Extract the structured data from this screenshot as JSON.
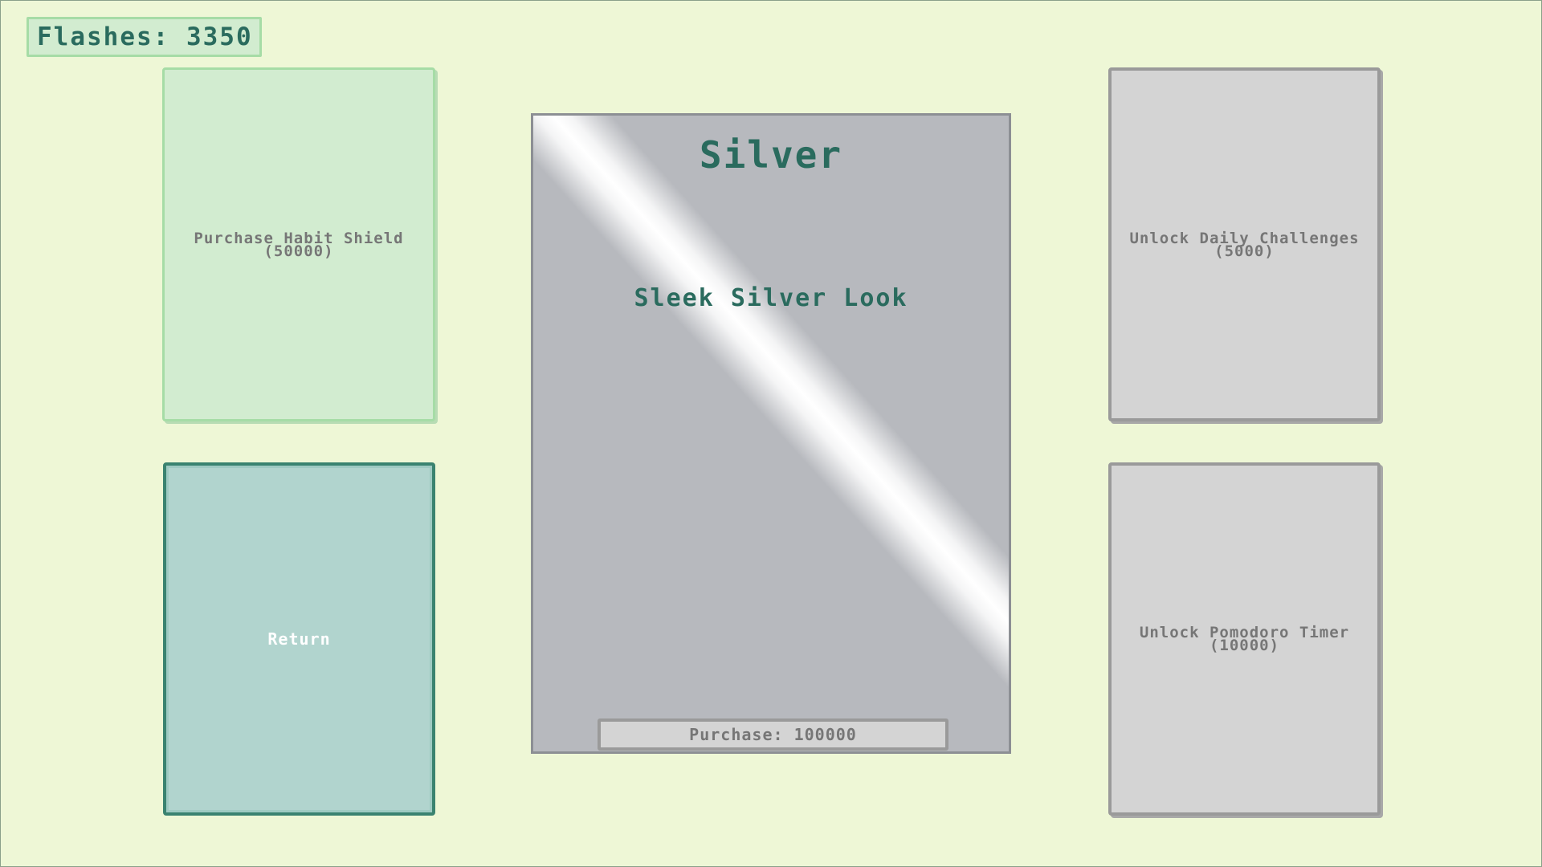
{
  "hud": {
    "flashes_label": "Flashes: 3350"
  },
  "cards": {
    "habit_shield": {
      "label": "Purchase Habit Shield",
      "price": "(50000)"
    },
    "return": {
      "label": "Return"
    },
    "daily_challenges": {
      "label": "Unlock Daily Challenges",
      "price": "(5000)"
    },
    "pomodoro": {
      "label": "Unlock Pomodoro Timer",
      "price": "(10000)"
    }
  },
  "featured": {
    "title": "Silver",
    "description": "Sleek Silver Look",
    "purchase_label": "Purchase: 100000"
  },
  "colors": {
    "background": "#eef7d6",
    "accent_green": "#2a6b5e",
    "card_green": "#d2ecd0",
    "card_teal": "#b1d4ce",
    "card_gray": "#d4d4d4",
    "silver": "#b7b9be"
  }
}
